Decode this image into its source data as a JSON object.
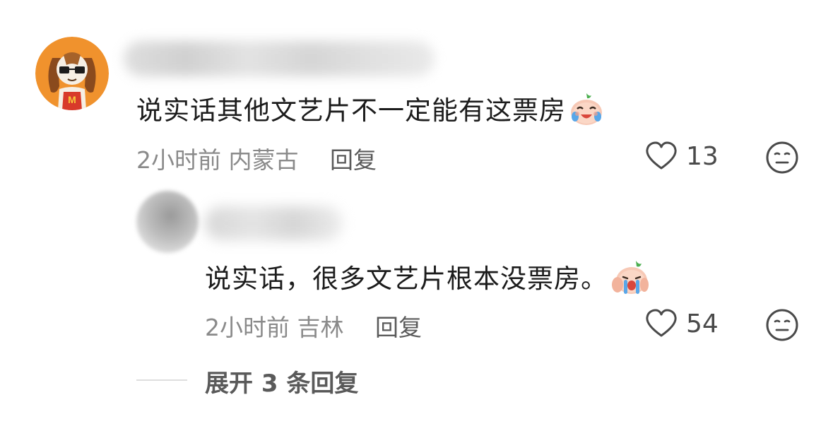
{
  "comments": [
    {
      "text": "说实话其他文艺片不一定能有这票房",
      "emoji_icon": "laugh-cry-emoji",
      "time": "2小时前",
      "location": "内蒙古",
      "reply_label": "回复",
      "likes": "13"
    }
  ],
  "reply": {
    "text": "说实话，很多文艺片根本没票房。",
    "emoji_icon": "cry-emoji",
    "time": "2小时前",
    "location": "吉林",
    "reply_label": "回复",
    "likes": "54"
  },
  "expand": {
    "label": "展开 3 条回复"
  },
  "colors": {
    "text": "#1c1c1c",
    "meta": "#8a8a8a",
    "avatar_bg": "#f0922d"
  }
}
